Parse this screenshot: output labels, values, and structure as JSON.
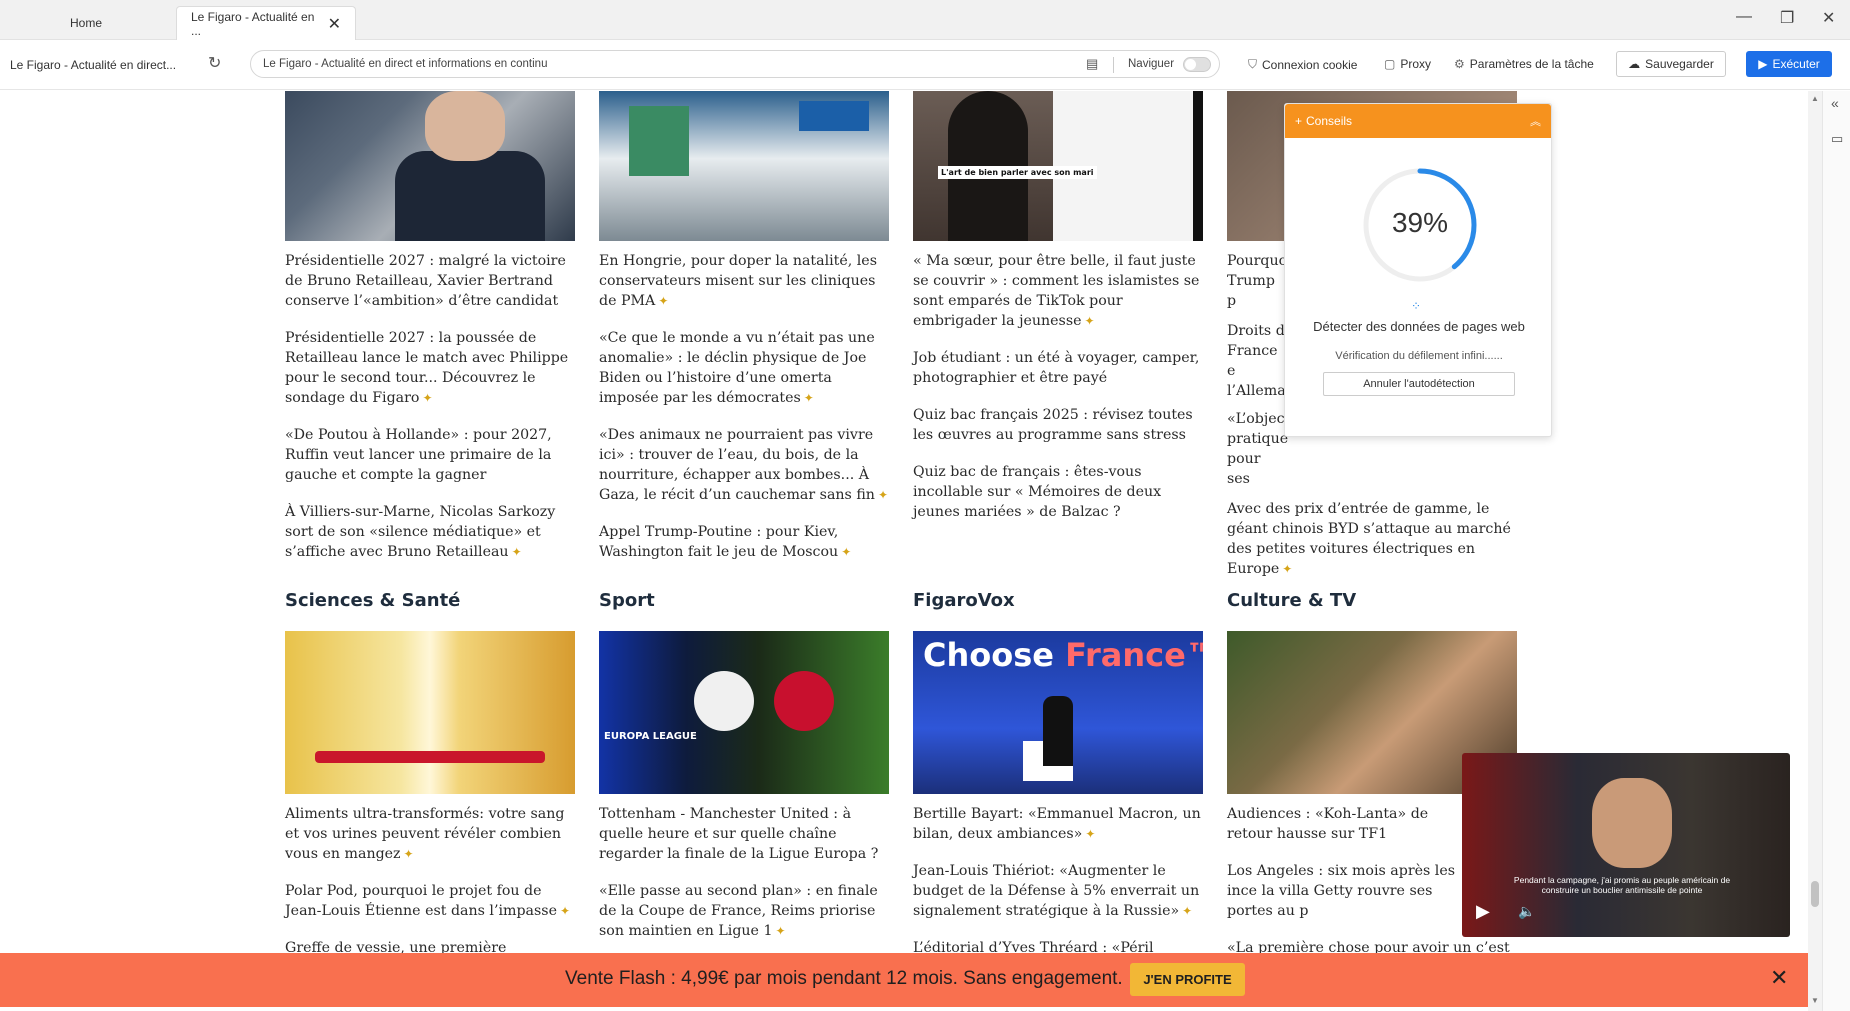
{
  "tabs": [
    {
      "label": "Home"
    },
    {
      "label": "Le Figaro - Actualité en ..."
    }
  ],
  "toolbar": {
    "page_title": "Le Figaro - Actualité en direct...",
    "url": "Le Figaro - Actualité en direct et informations en continu",
    "navigate_label": "Naviguer",
    "cookie_label": "Connexion cookie",
    "proxy_label": "Proxy",
    "task_settings_label": "Paramètres de la tâche",
    "save_label": "Sauvegarder",
    "run_label": "Exécuter"
  },
  "columns_top": [
    {
      "articles": [
        "Présidentielle 2027 : malgré la victoire de Bruno Retailleau, Xavier Bertrand conserve l’«ambition» d’être candidat",
        "Présidentielle 2027 : la poussée de Retailleau lance le match avec Philippe pour le second tour... Découvrez le sondage du Figaro",
        "«De Poutou à Hollande» : pour 2027, Ruffin veut lancer une primaire de la gauche et compte la gagner",
        "À Villiers-sur-Marne, Nicolas Sarkozy sort de son «silence médiatique» et s’affiche avec Bruno Retailleau"
      ]
    },
    {
      "articles": [
        "En Hongrie, pour doper la natalité, les conservateurs misent sur les cliniques de PMA",
        "«Ce que le monde a vu n’était pas une anomalie» : le déclin physique de Joe Biden ou l’histoire d’une omerta imposée par les démocrates",
        "«Des animaux ne pourraient pas vivre ici» : trouver de l’eau, du bois, de la nourriture, échapper aux bombes... À Gaza, le récit d’un cauchemar sans fin",
        "Appel Trump-Poutine : pour Kiev, Washington fait le jeu de Moscou"
      ]
    },
    {
      "articles": [
        "« Ma sœur, pour être belle, il faut juste se couvrir » : comment les islamistes se sont emparés de TikTok pour embrigader la jeunesse",
        "Job étudiant : un été à voyager, camper, photographier et être payé",
        "Quiz bac français 2025 : révisez toutes les œuvres au programme sans stress",
        "Quiz bac de français : êtes-vous incollable sur « Mémoires de deux jeunes mariées » de Balzac ?"
      ],
      "image_caption": "L'art de bien parler avec son mari"
    },
    {
      "articles": [
        "Pourquo Trump p",
        "Droits d France e l’Allemag",
        "«L’object pratique pour ses",
        "Avec des prix d’entrée de gamme, le géant chinois BYD s’attaque au marché des petites voitures électriques en Europe"
      ]
    }
  ],
  "sections": [
    {
      "title": "Sciences & Santé",
      "articles": [
        "Aliments ultra-transformés: votre sang et vos urines peuvent révéler combien vous en mangez",
        "Polar Pod, pourquoi le projet fou de Jean-Louis Étienne est dans l’impasse",
        "Greffe de vessie, une première mondiale"
      ]
    },
    {
      "title": "Sport",
      "articles": [
        "Tottenham - Manchester United : à quelle heure et sur quelle chaîne regarder la finale de la Ligue Europa ?",
        "«Elle passe au second plan» : en finale de la Coupe de France, Reims priorise son maintien en Ligue 1"
      ],
      "image_text": "EUROPA LEAGUE"
    },
    {
      "title": "FigaroVox",
      "articles": [
        "Bertille Bayart: «Emmanuel Macron, un bilan, deux ambiances»",
        "Jean-Louis Thiériot: «Augmenter le budget de la Défense à 5% enverrait un signalement stratégique à la Russie»",
        "L’éditorial d’Yves Thréard : «Péril islamiste"
      ],
      "image_title_a": "Choose ",
      "image_title_b": "France™"
    },
    {
      "title": "Culture & TV",
      "articles": [
        "Audiences : «Koh-Lanta» de retour hausse sur TF1",
        "Los Angeles : six mois après les ince la villa Getty rouvre ses portes au p",
        "«La première chose pour avoir un c’est de trouver la personne» : Tatiana Silva"
      ]
    }
  ],
  "panel": {
    "title": "Conseils",
    "progress_text": "39%",
    "progress": 0.39,
    "status": "Détecter des données de pages web",
    "substatus": "Vérification du défilement infini......",
    "cancel_label": "Annuler l'autodétection"
  },
  "video": {
    "subtitle": "Pendant la campagne, j'ai promis au peuple américain de construire un bouclier antimissile de pointe"
  },
  "banner": {
    "text": "Vente Flash : 4,99€ par mois pendant 12 mois. Sans engagement.",
    "cta": "J'EN PROFITE"
  },
  "colors": {
    "accent": "#1d6fe8",
    "panel_header": "#f6921e",
    "banner": "#f9704f",
    "cta": "#f2b736",
    "premium_icon": "#d6a419"
  }
}
